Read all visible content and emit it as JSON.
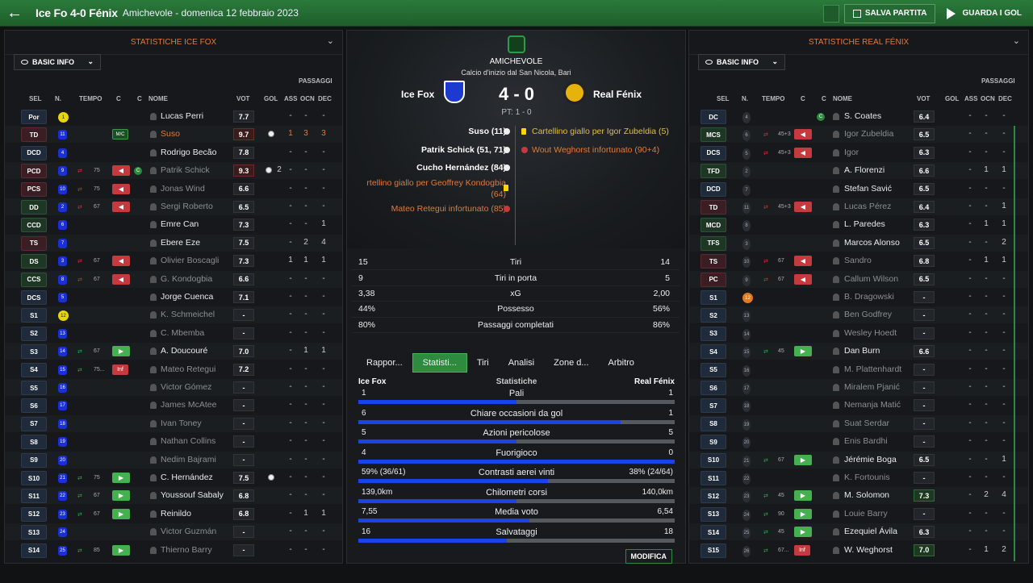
{
  "header": {
    "title": "Ice Fo 4-0 Fénix",
    "subtitle": "Amichevole - domenica 12 febbraio 2023",
    "save_label": "SALVA PARTITA",
    "watch_label": "GUARDA I GOL"
  },
  "left": {
    "panel_title": "STATISTICHE ICE FOX",
    "dropdown": "BASIC INFO",
    "passaggi_label": "PASSAGGI",
    "cols": {
      "sel": "SEL",
      "n": "N.",
      "tempo": "TEMPO",
      "c1": "C",
      "c2": "C",
      "nome": "NOME",
      "vot": "VOT",
      "gol": "GOL",
      "ass": "ASS",
      "ocn": "OCN",
      "dec": "DEC"
    },
    "players": [
      {
        "pos": "Por",
        "num": "1",
        "name": "Lucas Perri",
        "vot": "7.7",
        "gol": "",
        "ass": "-",
        "ocn": "-",
        "dec": "-"
      },
      {
        "pos": "TD",
        "num": "11",
        "name": "Suso",
        "vot": "9.7",
        "gol": "",
        "ass": "1",
        "ocn": "3",
        "dec": "3",
        "card": "M/C"
      },
      {
        "pos": "DCD",
        "num": "4",
        "name": "Rodrigo Becão",
        "vot": "7.8",
        "gol": "",
        "ass": "-",
        "ocn": "-",
        "dec": "-"
      },
      {
        "pos": "PCD",
        "num": "9",
        "name": "Patrik Schick",
        "vot": "9.3",
        "gol": "2",
        "ass": "-",
        "ocn": "-",
        "dec": "-",
        "tmin": "75"
      },
      {
        "pos": "PCS",
        "num": "10",
        "name": "Jonas Wind",
        "vot": "6.6",
        "gol": "",
        "ass": "-",
        "ocn": "-",
        "dec": "-",
        "tmin": "75"
      },
      {
        "pos": "DD",
        "num": "2",
        "name": "Sergi Roberto",
        "vot": "6.5",
        "gol": "",
        "ass": "-",
        "ocn": "-",
        "dec": "-",
        "tmin": "67"
      },
      {
        "pos": "CCD",
        "num": "6",
        "name": "Emre Can",
        "vot": "7.3",
        "gol": "",
        "ass": "-",
        "ocn": "-",
        "dec": "1"
      },
      {
        "pos": "TS",
        "num": "7",
        "name": "Ebere Eze",
        "vot": "7.5",
        "gol": "",
        "ass": "-",
        "ocn": "2",
        "dec": "4"
      },
      {
        "pos": "DS",
        "num": "3",
        "name": "Olivier Boscagli",
        "vot": "7.3",
        "gol": "",
        "ass": "1",
        "ocn": "1",
        "dec": "1",
        "tmin": "67"
      },
      {
        "pos": "CCS",
        "num": "8",
        "name": "G. Kondogbia",
        "vot": "6.6",
        "gol": "",
        "ass": "-",
        "ocn": "-",
        "dec": "-",
        "tmin": "67"
      },
      {
        "pos": "DCS",
        "num": "5",
        "name": "Jorge Cuenca",
        "vot": "7.1",
        "gol": "",
        "ass": "-",
        "ocn": "-",
        "dec": "-"
      },
      {
        "pos": "S1",
        "num": "12",
        "name": "K. Schmeichel",
        "vot": "-",
        "gol": "",
        "ass": "-",
        "ocn": "-",
        "dec": "-"
      },
      {
        "pos": "S2",
        "num": "13",
        "name": "C. Mbemba",
        "vot": "-",
        "gol": "",
        "ass": "-",
        "ocn": "-",
        "dec": "-"
      },
      {
        "pos": "S3",
        "num": "14",
        "name": "A. Doucouré",
        "vot": "7.0",
        "gol": "",
        "ass": "-",
        "ocn": "1",
        "dec": "1",
        "tmin": "67"
      },
      {
        "pos": "S4",
        "num": "15",
        "name": "Mateo Retegui",
        "vot": "7.2",
        "gol": "",
        "ass": "-",
        "ocn": "-",
        "dec": "-",
        "tmin": "75...",
        "card": "Inf"
      },
      {
        "pos": "S5",
        "num": "16",
        "name": "Victor Gómez",
        "vot": "-",
        "gol": "",
        "ass": "-",
        "ocn": "-",
        "dec": "-"
      },
      {
        "pos": "S6",
        "num": "17",
        "name": "James McAtee",
        "vot": "-",
        "gol": "",
        "ass": "-",
        "ocn": "-",
        "dec": "-"
      },
      {
        "pos": "S7",
        "num": "18",
        "name": "Ivan Toney",
        "vot": "-",
        "gol": "",
        "ass": "-",
        "ocn": "-",
        "dec": "-"
      },
      {
        "pos": "S8",
        "num": "19",
        "name": "Nathan Collins",
        "vot": "-",
        "gol": "",
        "ass": "-",
        "ocn": "-",
        "dec": "-"
      },
      {
        "pos": "S9",
        "num": "20",
        "name": "Nedim Bajrami",
        "vot": "-",
        "gol": "",
        "ass": "-",
        "ocn": "-",
        "dec": "-"
      },
      {
        "pos": "S10",
        "num": "21",
        "name": "C. Hernández",
        "vot": "7.5",
        "gol": "",
        "ass": "-",
        "ocn": "-",
        "dec": "-",
        "tmin": "75"
      },
      {
        "pos": "S11",
        "num": "22",
        "name": "Youssouf Sabaly",
        "vot": "6.8",
        "gol": "",
        "ass": "-",
        "ocn": "-",
        "dec": "-",
        "tmin": "67"
      },
      {
        "pos": "S12",
        "num": "23",
        "name": "Reinildo",
        "vot": "6.8",
        "gol": "",
        "ass": "-",
        "ocn": "1",
        "dec": "1",
        "tmin": "67"
      },
      {
        "pos": "S13",
        "num": "24",
        "name": "Victor Guzmán",
        "vot": "-",
        "gol": "",
        "ass": "-",
        "ocn": "-",
        "dec": "-"
      },
      {
        "pos": "S14",
        "num": "25",
        "name": "Thierno Barry",
        "vot": "-",
        "gol": "",
        "ass": "-",
        "ocn": "-",
        "dec": "-",
        "tmin": "85"
      }
    ]
  },
  "right": {
    "panel_title": "STATISTICHE REAL FÉNIX",
    "dropdown": "BASIC INFO",
    "passaggi_label": "PASSAGGI",
    "cols": {
      "sel": "SEL",
      "n": "N.",
      "tempo": "TEMPO",
      "c1": "C",
      "c2": "C",
      "nome": "NOME",
      "vot": "VOT",
      "gol": "GOL",
      "ass": "ASS",
      "ocn": "OCN",
      "dec": "DEC"
    },
    "players": [
      {
        "pos": "DC",
        "num": "4",
        "name": "S. Coates",
        "vot": "6.4",
        "ass": "-",
        "ocn": "-",
        "dec": "-"
      },
      {
        "pos": "MCS",
        "num": "6",
        "name": "Igor Zubeldia",
        "vot": "6.5",
        "ass": "-",
        "ocn": "-",
        "dec": "-",
        "tmin": "45+3"
      },
      {
        "pos": "DCS",
        "num": "5",
        "name": "Igor",
        "vot": "6.3",
        "ass": "-",
        "ocn": "-",
        "dec": "-",
        "tmin": "45+3"
      },
      {
        "pos": "TFD",
        "num": "2",
        "name": "A. Florenzi",
        "vot": "6.6",
        "ass": "-",
        "ocn": "1",
        "dec": "1"
      },
      {
        "pos": "DCD",
        "num": "7",
        "name": "Stefan Savić",
        "vot": "6.5",
        "ass": "-",
        "ocn": "-",
        "dec": "-"
      },
      {
        "pos": "TD",
        "num": "11",
        "name": "Lucas Pérez",
        "vot": "6.4",
        "ass": "-",
        "ocn": "-",
        "dec": "1",
        "tmin": "45+3"
      },
      {
        "pos": "MCD",
        "num": "8",
        "name": "L. Paredes",
        "vot": "6.3",
        "ass": "-",
        "ocn": "1",
        "dec": "1"
      },
      {
        "pos": "TFS",
        "num": "3",
        "name": "Marcos Alonso",
        "vot": "6.5",
        "ass": "-",
        "ocn": "-",
        "dec": "2"
      },
      {
        "pos": "TS",
        "num": "10",
        "name": "Sandro",
        "vot": "6.8",
        "ass": "-",
        "ocn": "1",
        "dec": "1",
        "tmin": "67"
      },
      {
        "pos": "PC",
        "num": "9",
        "name": "Callum Wilson",
        "vot": "6.5",
        "ass": "-",
        "ocn": "-",
        "dec": "-",
        "tmin": "67"
      },
      {
        "pos": "S1",
        "num": "12",
        "name": "B. Dragowski",
        "vot": "-",
        "ass": "-",
        "ocn": "-",
        "dec": "-"
      },
      {
        "pos": "S2",
        "num": "13",
        "name": "Ben Godfrey",
        "vot": "-",
        "ass": "-",
        "ocn": "-",
        "dec": "-"
      },
      {
        "pos": "S3",
        "num": "14",
        "name": "Wesley Hoedt",
        "vot": "-",
        "ass": "-",
        "ocn": "-",
        "dec": "-"
      },
      {
        "pos": "S4",
        "num": "15",
        "name": "Dan Burn",
        "vot": "6.6",
        "ass": "-",
        "ocn": "-",
        "dec": "-",
        "tmin": "45"
      },
      {
        "pos": "S5",
        "num": "16",
        "name": "M. Plattenhardt",
        "vot": "-",
        "ass": "-",
        "ocn": "-",
        "dec": "-"
      },
      {
        "pos": "S6",
        "num": "17",
        "name": "Miralem Pjanić",
        "vot": "-",
        "ass": "-",
        "ocn": "-",
        "dec": "-"
      },
      {
        "pos": "S7",
        "num": "18",
        "name": "Nemanja Matić",
        "vot": "-",
        "ass": "-",
        "ocn": "-",
        "dec": "-"
      },
      {
        "pos": "S8",
        "num": "19",
        "name": "Suat Serdar",
        "vot": "-",
        "ass": "-",
        "ocn": "-",
        "dec": "-"
      },
      {
        "pos": "S9",
        "num": "20",
        "name": "Enis Bardhi",
        "vot": "-",
        "ass": "-",
        "ocn": "-",
        "dec": "-"
      },
      {
        "pos": "S10",
        "num": "21",
        "name": "Jérémie Boga",
        "vot": "6.5",
        "ass": "-",
        "ocn": "-",
        "dec": "1",
        "tmin": "67"
      },
      {
        "pos": "S11",
        "num": "22",
        "name": "K. Fortounis",
        "vot": "-",
        "ass": "-",
        "ocn": "-",
        "dec": "-"
      },
      {
        "pos": "S12",
        "num": "23",
        "name": "M. Solomon",
        "vot": "7.3",
        "ass": "-",
        "ocn": "2",
        "dec": "4",
        "tmin": "45"
      },
      {
        "pos": "S13",
        "num": "24",
        "name": "Louie Barry",
        "vot": "-",
        "ass": "-",
        "ocn": "-",
        "dec": "-",
        "tmin": "90"
      },
      {
        "pos": "S14",
        "num": "25",
        "name": "Ezequiel Ávila",
        "vot": "6.3",
        "ass": "-",
        "ocn": "-",
        "dec": "-",
        "tmin": "45"
      },
      {
        "pos": "S15",
        "num": "26",
        "name": "W. Weghorst",
        "vot": "7.0",
        "ass": "-",
        "ocn": "1",
        "dec": "2",
        "tmin": "67...",
        "card": "Inf"
      }
    ]
  },
  "match": {
    "competition": "AMICHEVOLE",
    "venue": "Calcio d'inizio dal San Nicola, Bari",
    "home": "Ice Fox",
    "away": "Real Fénix",
    "score": "4 - 0",
    "ht": "PT: 1 - 0",
    "events_left": [
      "Suso (11)",
      "Patrik Schick (51, 71)",
      "Cucho Hernández (84)",
      "rtellino giallo per Geoffrey Kondogbia",
      "(64)",
      "Mateo Retegui infortunato (85)"
    ],
    "events_right": [
      "Cartellino giallo per Igor Zubeldia (5)",
      "Wout Weghorst infortunato (90+4)"
    ]
  },
  "summary": [
    {
      "a": "15",
      "label": "Tiri",
      "b": "14"
    },
    {
      "a": "9",
      "label": "Tiri in porta",
      "b": "5"
    },
    {
      "a": "3,38",
      "label": "xG",
      "b": "2,00"
    },
    {
      "a": "44%",
      "label": "Possesso",
      "b": "56%"
    },
    {
      "a": "80%",
      "label": "Passaggi completati",
      "b": "86%"
    }
  ],
  "tabs": [
    "Rappor...",
    "Statisti...",
    "Tiri",
    "Analisi",
    "Zone d...",
    "Arbitro"
  ],
  "stats_header": {
    "home": "Ice Fox",
    "mid": "Statistiche",
    "away": "Real Fénix"
  },
  "stats": [
    {
      "label": "Pali",
      "a": "1",
      "b": "1",
      "frac": 0.5
    },
    {
      "label": "Chiare occasioni da gol",
      "a": "6",
      "b": "1",
      "frac": 0.83
    },
    {
      "label": "Azioni pericolose",
      "a": "5",
      "b": "5",
      "frac": 0.5
    },
    {
      "label": "Fuorigioco",
      "a": "4",
      "b": "0",
      "frac": 1.0
    },
    {
      "label": "Contrasti aerei vinti",
      "a": "59% (36/61)",
      "b": "38% (24/64)",
      "frac": 0.6
    },
    {
      "label": "Chilometri corsi",
      "a": "139,0km",
      "b": "140,0km",
      "frac": 0.5
    },
    {
      "label": "Media voto",
      "a": "7,55",
      "b": "6,54",
      "frac": 0.54
    },
    {
      "label": "Salvataggi",
      "a": "16",
      "b": "18",
      "frac": 0.47
    }
  ],
  "modify_label": "MODIFICA",
  "colors": {
    "accent": "#2e8a3e",
    "orange": "#e07a3c",
    "bar": "#1a44e8"
  }
}
